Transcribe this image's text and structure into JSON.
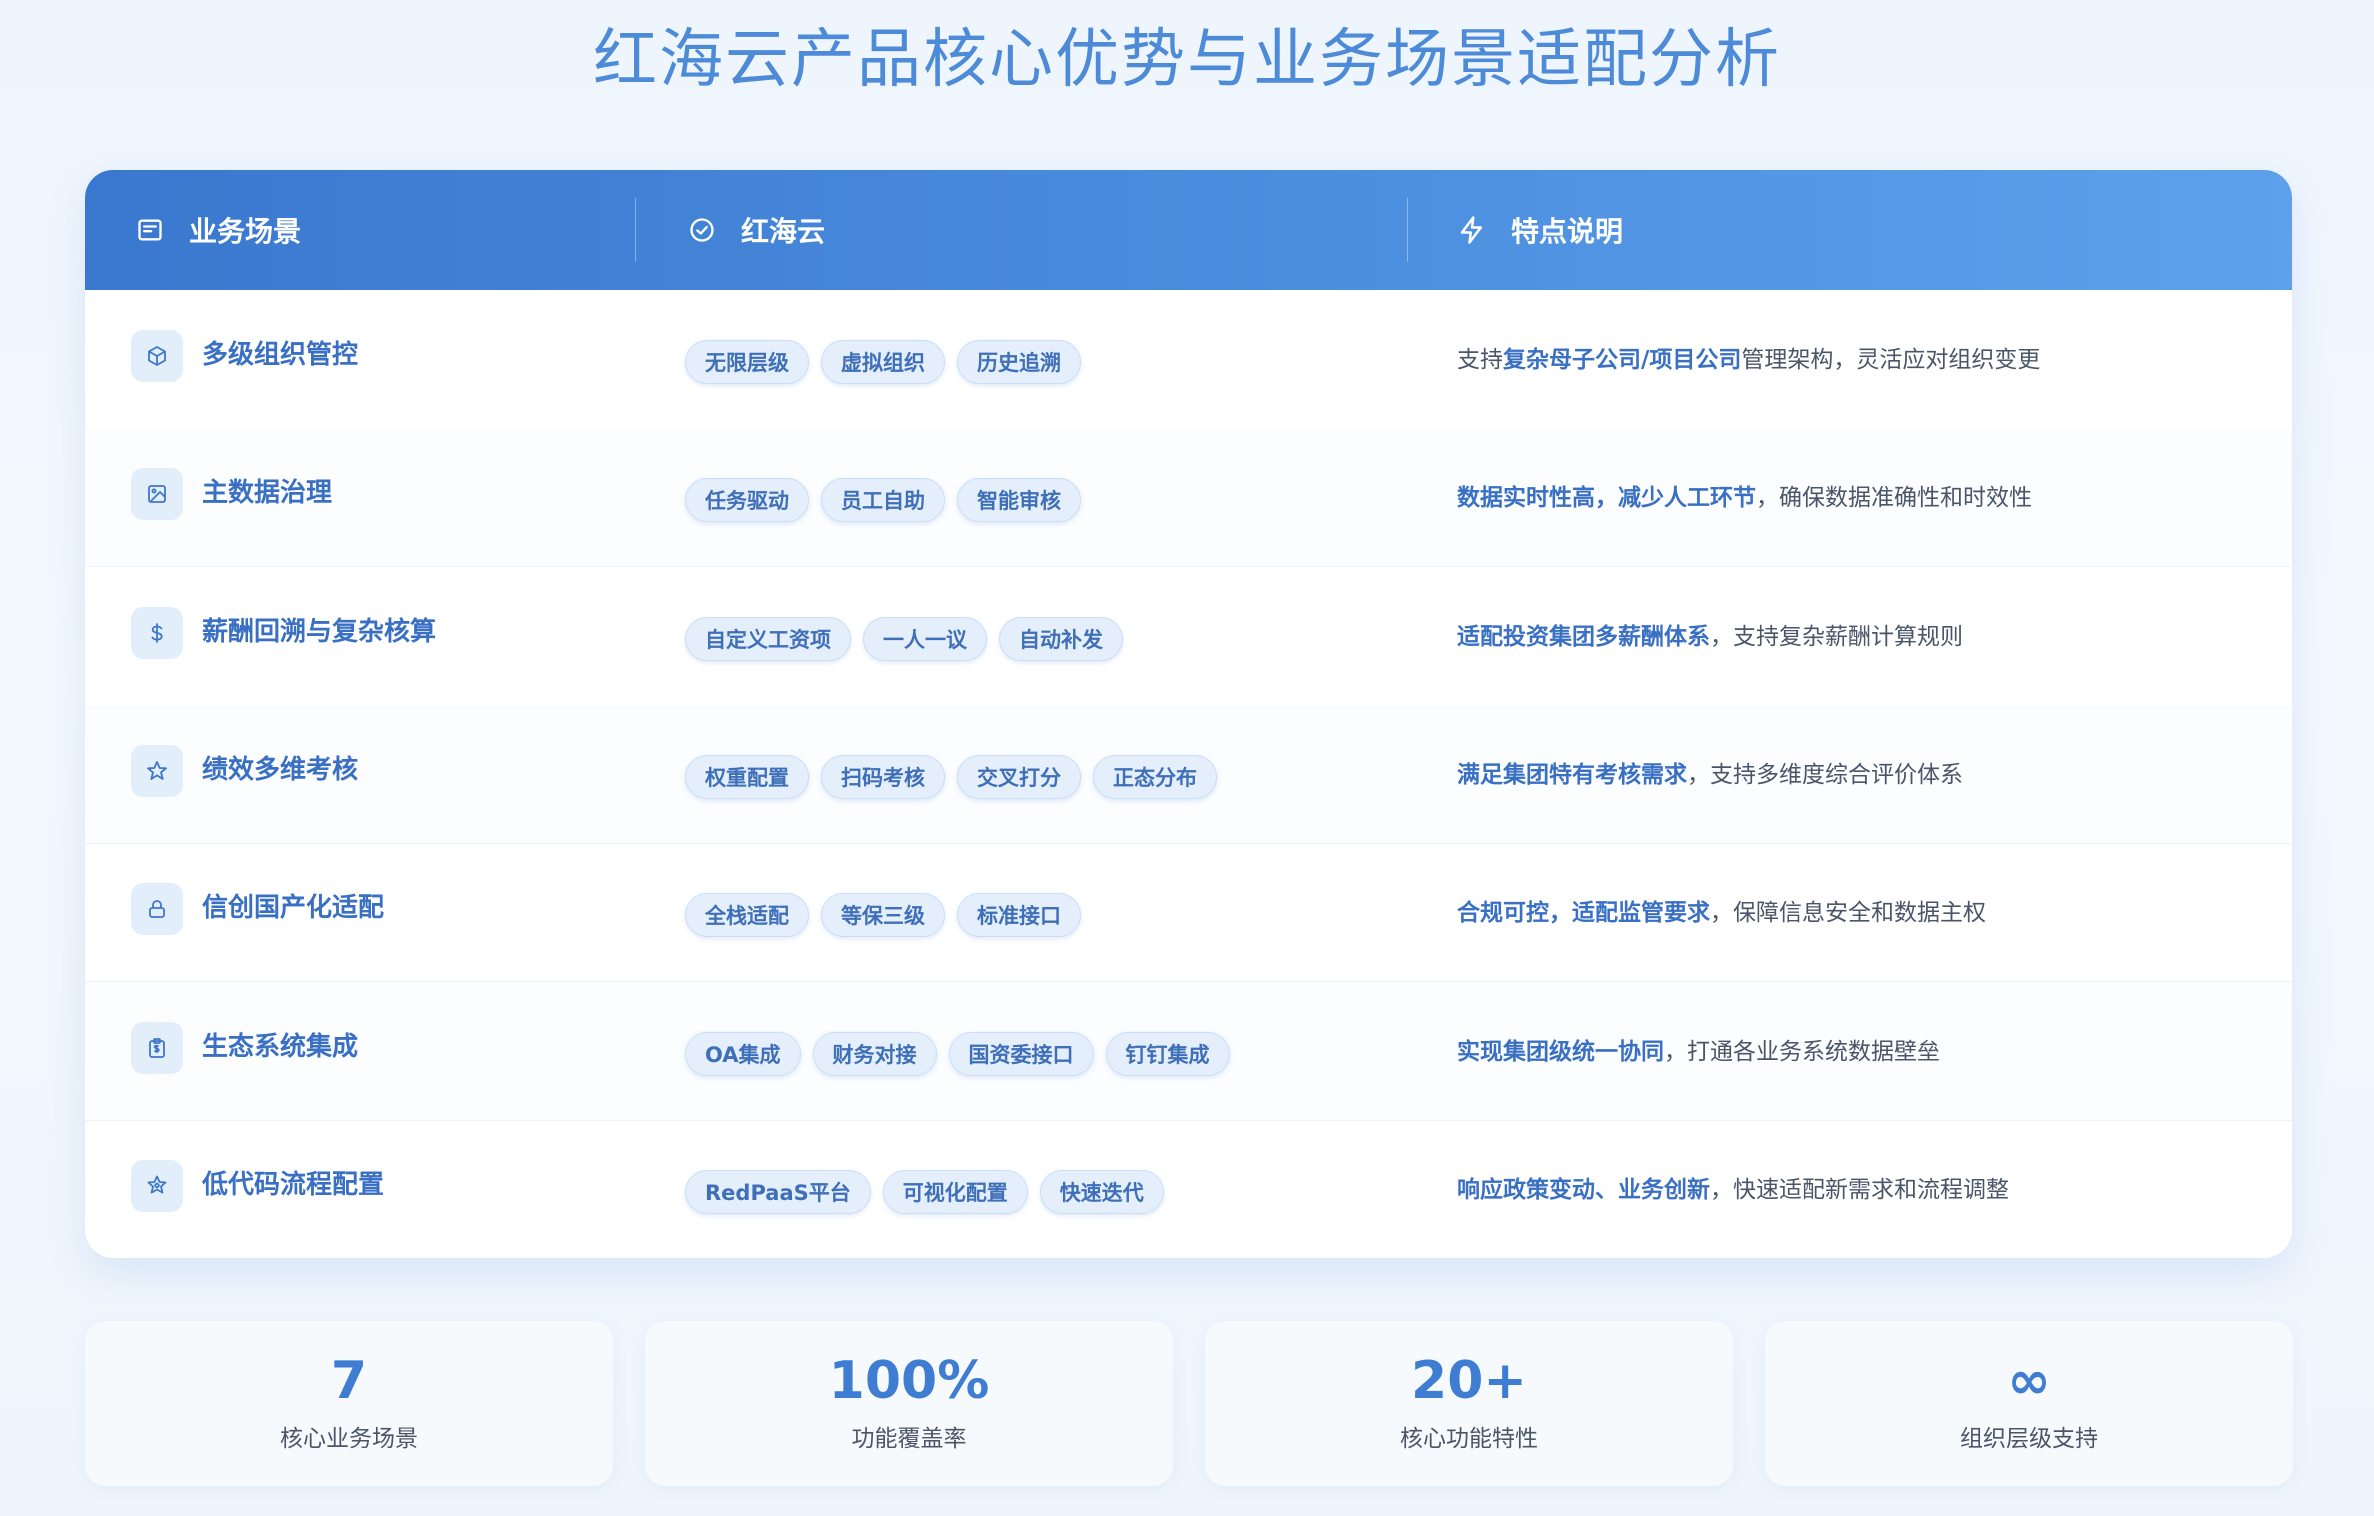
{
  "title": "红海云产品核心优势与业务场景适配分析",
  "header": {
    "col1": {
      "label": "业务场景",
      "icon": "card-icon"
    },
    "col2": {
      "label": "红海云",
      "icon": "check-circle-icon"
    },
    "col3": {
      "label": "特点说明",
      "icon": "lightning-icon"
    }
  },
  "rows": [
    {
      "name": "多级组织管控",
      "icon": "cube-icon",
      "tags": [
        "无限层级",
        "虚拟组织",
        "历史追溯"
      ],
      "desc": {
        "pre": "支持",
        "highlight": "复杂母子公司/项目公司",
        "rest": "管理架构，灵活应对组织变更"
      }
    },
    {
      "name": "主数据治理",
      "icon": "image-icon",
      "tags": [
        "任务驱动",
        "员工自助",
        "智能审核"
      ],
      "desc": {
        "pre": "",
        "highlight": "数据实时性高，减少人工环节",
        "rest": "，确保数据准确性和时效性"
      }
    },
    {
      "name": "薪酬回溯与复杂核算",
      "icon": "dollar-icon",
      "tags": [
        "自定义工资项",
        "一人一议",
        "自动补发"
      ],
      "desc": {
        "pre": "",
        "highlight": "适配投资集团多薪酬体系",
        "rest": "，支持复杂薪酬计算规则"
      }
    },
    {
      "name": "绩效多维考核",
      "icon": "star-icon",
      "tags": [
        "权重配置",
        "扫码考核",
        "交叉打分",
        "正态分布"
      ],
      "desc": {
        "pre": "",
        "highlight": "满足集团特有考核需求",
        "rest": "，支持多维度综合评价体系"
      }
    },
    {
      "name": "信创国产化适配",
      "icon": "lock-icon",
      "tags": [
        "全栈适配",
        "等保三级",
        "标准接口"
      ],
      "desc": {
        "pre": "",
        "highlight": "合规可控，适配监管要求",
        "rest": "，保障信息安全和数据主权"
      }
    },
    {
      "name": "生态系统集成",
      "icon": "clipboard-icon",
      "tags": [
        "OA集成",
        "财务对接",
        "国资委接口",
        "钉钉集成"
      ],
      "desc": {
        "pre": "",
        "highlight": "实现集团级统一协同",
        "rest": "，打通各业务系统数据壁垒"
      }
    },
    {
      "name": "低代码流程配置",
      "icon": "star-badge-icon",
      "tags": [
        "RedPaaS平台",
        "可视化配置",
        "快速迭代"
      ],
      "desc": {
        "pre": "",
        "highlight": "响应政策变动、业务创新",
        "rest": "，快速适配新需求和流程调整"
      }
    }
  ],
  "stats": [
    {
      "value": "7",
      "label": "核心业务场景"
    },
    {
      "value": "100%",
      "label": "功能覆盖率"
    },
    {
      "value": "20+",
      "label": "核心功能特性"
    },
    {
      "value": "∞",
      "label": "组织层级支持"
    }
  ],
  "colors": {
    "accent": "#3a78cf",
    "text_highlight": "#3a70c4",
    "tag_bg": "#e4effb"
  }
}
